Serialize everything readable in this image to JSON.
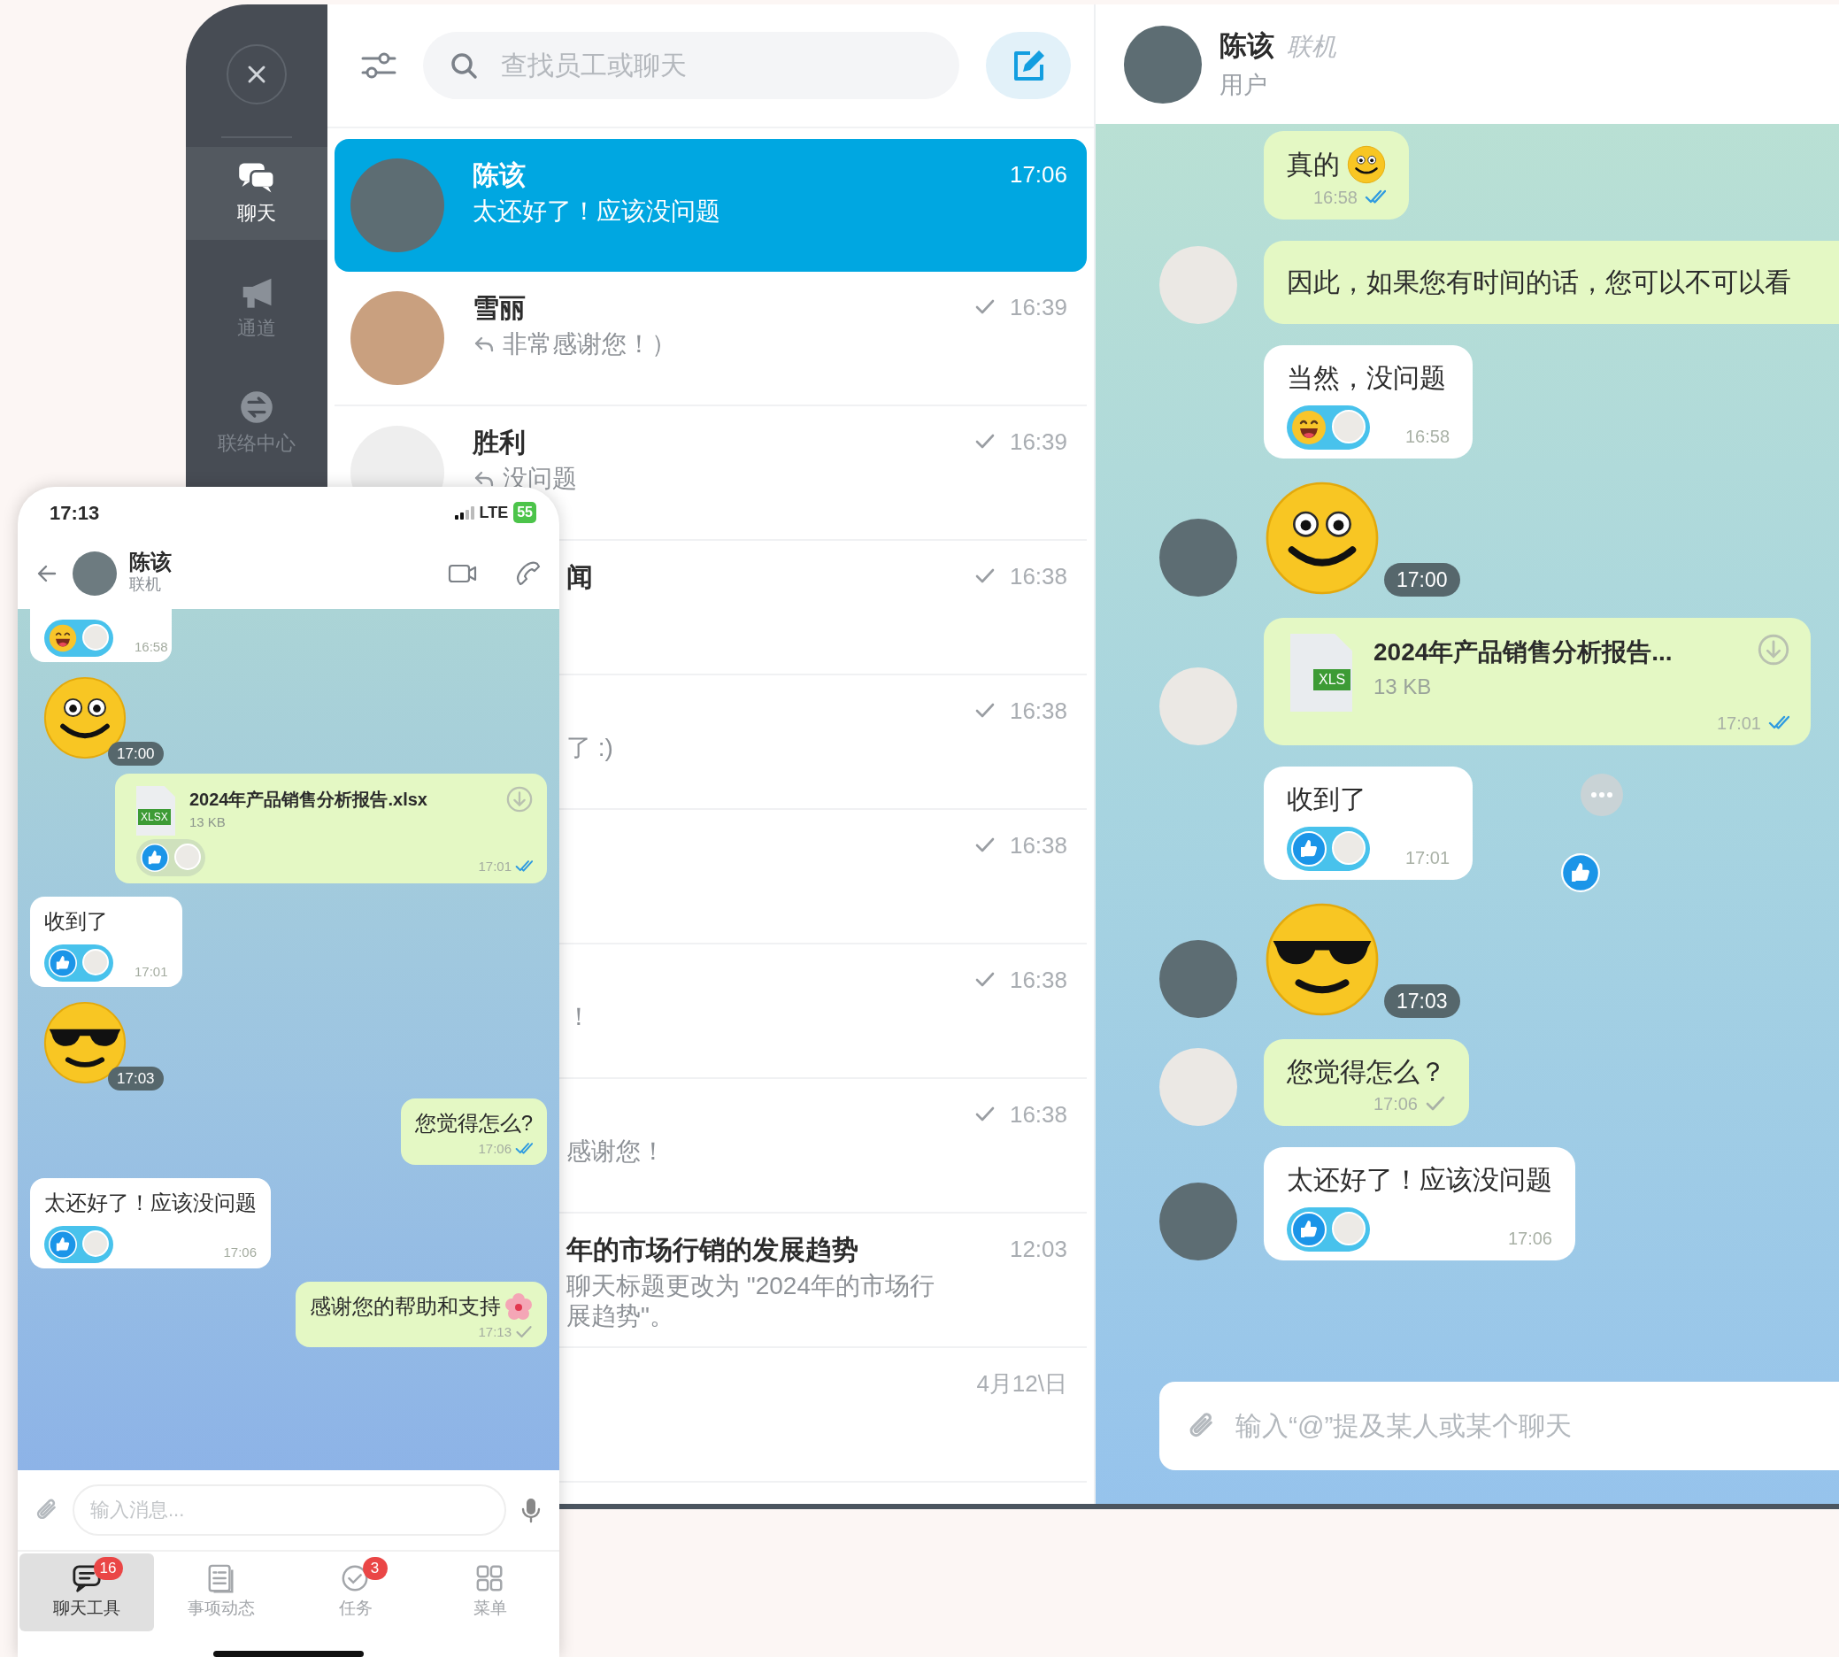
{
  "sidebar": {
    "items": [
      {
        "label": "聊天",
        "selected": true
      },
      {
        "label": "通道",
        "selected": false
      },
      {
        "label": "联络中心",
        "selected": false
      }
    ]
  },
  "chat_list": {
    "search": {
      "placeholder": "查找员工或聊天"
    },
    "items": [
      {
        "kind": "contact",
        "name": "陈该",
        "preview": "太还好了！应该没问题",
        "time": "17:06",
        "selected": true,
        "delivered": false,
        "reply": false
      },
      {
        "kind": "contact",
        "name": "雪丽",
        "preview": "非常感谢您！）",
        "time": "16:39",
        "selected": false,
        "delivered": true,
        "reply": true
      },
      {
        "kind": "contact",
        "name": "胜利",
        "preview": "没问题",
        "time": "16:39",
        "selected": false,
        "delivered": true,
        "reply": true
      },
      {
        "kind": "covered",
        "name": "闻",
        "time": "16:38",
        "selected": false,
        "delivered": true
      },
      {
        "kind": "covered",
        "preview": "了 :)",
        "time": "16:38",
        "selected": false,
        "delivered": true
      },
      {
        "kind": "covered",
        "time": "16:38",
        "selected": false,
        "delivered": true
      },
      {
        "kind": "covered",
        "preview": "！",
        "time": "16:38",
        "selected": false,
        "delivered": true
      },
      {
        "kind": "covered",
        "preview": "感谢您！",
        "time": "16:38",
        "selected": false,
        "delivered": true
      },
      {
        "kind": "covered",
        "name": "年的市场行销的发展趋势",
        "preview_lines": [
          "聊天标题更改为 \"2024年的市场行",
          "展趋势\"。"
        ],
        "time": "12:03",
        "selected": false,
        "delivered": false
      },
      {
        "kind": "covered",
        "time": "4月12\\日",
        "selected": false,
        "delivered": false
      }
    ]
  },
  "conversation": {
    "header": {
      "name": "陈该",
      "presence": "联机",
      "role": "用户"
    },
    "messages": [
      {
        "kind": "text",
        "own": true,
        "avatar": false,
        "text": "真的",
        "emoji": {
          "kind": "smile"
        },
        "time": "16:58",
        "read": true
      },
      {
        "kind": "text",
        "own": true,
        "avatar": true,
        "text": "因此，如果您有时间的话，您可以不可以看"
      },
      {
        "kind": "text",
        "own": false,
        "avatar": false,
        "text": "当然，没问题",
        "reaction": {
          "kind": "laugh",
          "highlighted": true
        },
        "time": "16:58"
      },
      {
        "kind": "sticker",
        "sticker": {
          "kind": "smile"
        },
        "own": false,
        "avatar": true,
        "time": "17:00"
      },
      {
        "kind": "file",
        "own": true,
        "avatar": true,
        "file_name": "2024年产品销售分析报告...",
        "file_type": "XLS",
        "size": "13 KB",
        "time": "17:01",
        "read": true
      },
      {
        "kind": "text",
        "own": false,
        "avatar": false,
        "text": "收到了",
        "reaction": {
          "kind": "like",
          "highlighted": true
        },
        "time": "17:01",
        "hover": true
      },
      {
        "kind": "sticker",
        "sticker": {
          "kind": "cool"
        },
        "own": false,
        "avatar": true,
        "time": "17:03"
      },
      {
        "kind": "text",
        "own": true,
        "avatar": true,
        "text": "您觉得怎么？",
        "time": "17:06",
        "read": false
      },
      {
        "kind": "text",
        "own": false,
        "avatar": true,
        "text": "太还好了！应该没问题",
        "reaction": {
          "kind": "like",
          "highlighted": true
        },
        "time": "17:06"
      }
    ],
    "composer": {
      "placeholder": "输入“@”提及某人或某个聊天"
    }
  },
  "phone": {
    "status_bar": {
      "time": "17:13",
      "network": "LTE",
      "battery": "55"
    },
    "header": {
      "name": "陈该",
      "presence": "联机"
    },
    "messages": [
      {
        "kind": "text",
        "own": false,
        "reaction": {
          "kind": "laugh",
          "highlighted": true
        },
        "time": "16:58"
      },
      {
        "kind": "sticker",
        "sticker": {
          "kind": "smile"
        },
        "own": false,
        "time": "17:00"
      },
      {
        "kind": "file",
        "own": true,
        "file_name": "2024年产品销售分析报告.xlsx",
        "file_type": "XLSX",
        "size": "13 KB",
        "reaction": {
          "kind": "like",
          "highlighted": false
        },
        "time": "17:01",
        "read": true
      },
      {
        "kind": "text",
        "own": false,
        "text": "收到了",
        "reaction": {
          "kind": "like",
          "highlighted": true
        },
        "time": "17:01"
      },
      {
        "kind": "sticker",
        "sticker": {
          "kind": "cool"
        },
        "own": false,
        "time": "17:03"
      },
      {
        "kind": "text",
        "own": true,
        "text": "您觉得怎么?",
        "time": "17:06",
        "read": true
      },
      {
        "kind": "text",
        "own": false,
        "text": "太还好了！应该没问题",
        "reaction": {
          "kind": "like",
          "highlighted": true
        },
        "time": "17:06"
      },
      {
        "kind": "text",
        "own": true,
        "text": "感谢您的帮助和支持",
        "emoji": {
          "kind": "flower"
        },
        "time": "17:13",
        "read": false
      }
    ],
    "composer": {
      "placeholder": "输入消息..."
    },
    "tabs": [
      {
        "label": "聊天工具",
        "badge": "16",
        "selected": true
      },
      {
        "label": "事项动态",
        "selected": false
      },
      {
        "label": "任务",
        "badge": "3",
        "selected": false
      },
      {
        "label": "菜单",
        "selected": false
      }
    ]
  }
}
